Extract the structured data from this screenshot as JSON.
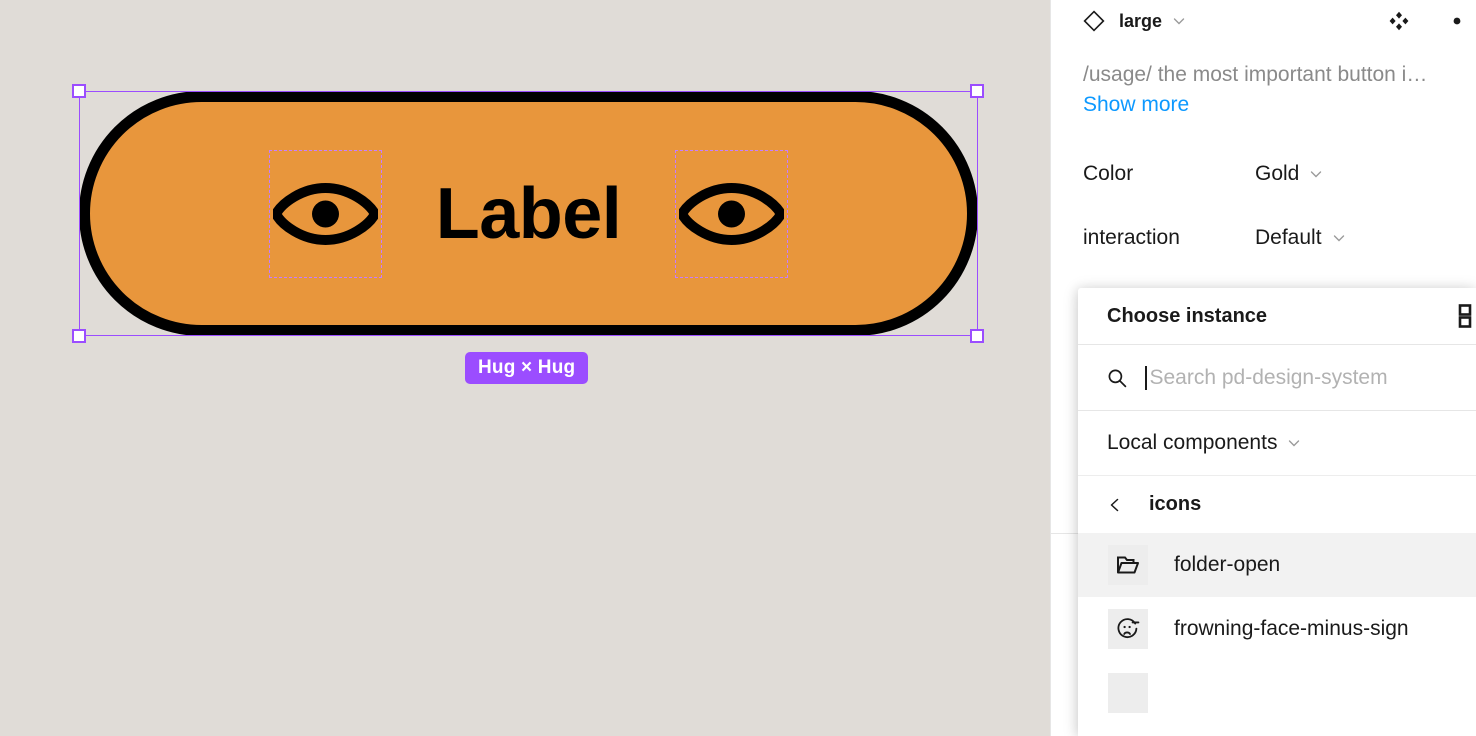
{
  "canvas": {
    "background_color": "#e0dcd7",
    "selection_color": "#9b4dff",
    "button": {
      "label": "Label",
      "fill_color": "#e8963c",
      "stroke_color": "#000000",
      "left_icon": "eye-icon",
      "right_icon": "eye-icon"
    },
    "size_badge": "Hug × Hug"
  },
  "sidebar": {
    "component": {
      "icon": "diamond-icon",
      "name": "large",
      "chevron": "chevron-down-icon"
    },
    "actions": {
      "swap_variant": "four-diamond-icon",
      "more": "dot-icon"
    },
    "usage": {
      "text": "/usage/ the most important button i…",
      "show_more": "Show more"
    },
    "properties": [
      {
        "label": "Color",
        "value": "Gold",
        "chevron": "chevron-down-icon"
      },
      {
        "label": "interaction",
        "value": "Default",
        "chevron": "chevron-down-icon"
      }
    ]
  },
  "popover": {
    "title": "Choose instance",
    "view_toggle_icon": "list-view-icon",
    "search": {
      "icon": "search-icon",
      "value": "",
      "placeholder": "Search pd-design-system"
    },
    "section": {
      "label": "Local components",
      "chevron": "chevron-down-icon"
    },
    "breadcrumb": {
      "back_icon": "chevron-left-icon",
      "label": "icons"
    },
    "items": [
      {
        "name": "folder-open",
        "icon": "folder-open-icon",
        "highlighted": true
      },
      {
        "name": "frowning-face-minus-sign",
        "icon": "frowning-face-minus-sign-icon",
        "highlighted": false
      }
    ]
  }
}
